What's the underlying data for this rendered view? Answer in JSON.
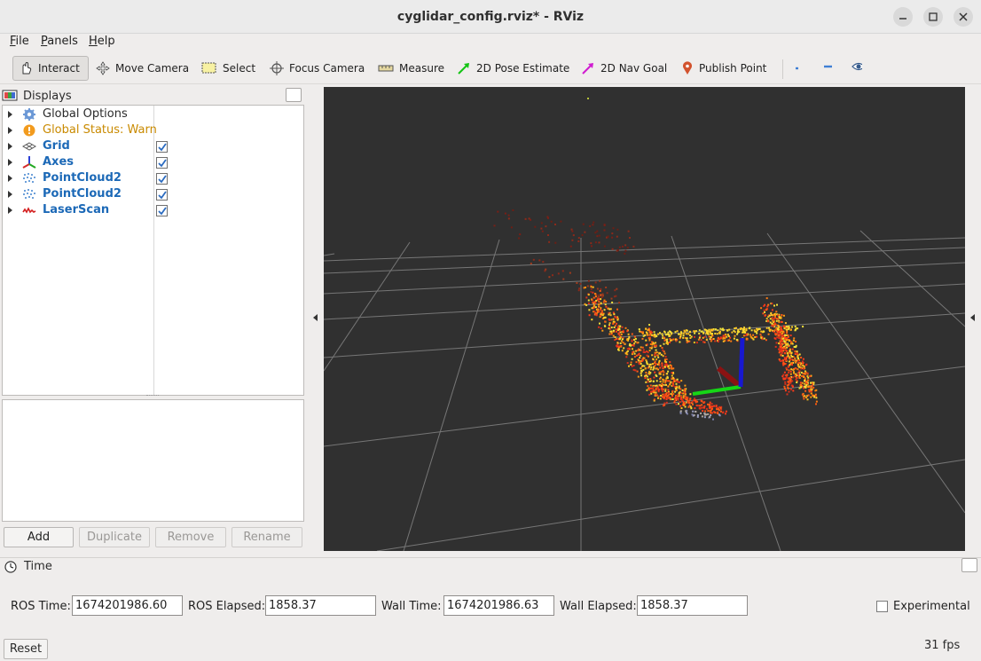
{
  "window": {
    "title": "cyglidar_config.rviz* - RViz"
  },
  "menu": [
    {
      "ul": "F",
      "rest": "ile"
    },
    {
      "ul": "P",
      "rest": "anels"
    },
    {
      "ul": "H",
      "rest": "elp"
    }
  ],
  "toolbar": {
    "interact": "Interact",
    "move_camera": "Move Camera",
    "select": "Select",
    "focus_camera": "Focus Camera",
    "measure": "Measure",
    "pose_estimate": "2D Pose Estimate",
    "nav_goal": "2D Nav Goal",
    "publish_point": "Publish Point"
  },
  "displays": {
    "title": "Displays",
    "items": [
      {
        "label": "Global Options",
        "icon": "gear-icon"
      },
      {
        "label": "Global Status: Warn",
        "icon": "warning-icon"
      },
      {
        "label": "Grid",
        "icon": "grid-icon",
        "checked": true
      },
      {
        "label": "Axes",
        "icon": "axes-icon",
        "checked": true
      },
      {
        "label": "PointCloud2",
        "icon": "pointcloud-icon",
        "checked": true
      },
      {
        "label": "PointCloud2",
        "icon": "pointcloud-icon",
        "checked": true
      },
      {
        "label": "LaserScan",
        "icon": "laserscan-icon",
        "checked": true
      }
    ],
    "buttons": {
      "add": "Add",
      "duplicate": "Duplicate",
      "remove": "Remove",
      "rename": "Rename"
    }
  },
  "time": {
    "title": "Time",
    "ros_time_label": "ROS Time:",
    "ros_time": "1674201986.60",
    "ros_elapsed_label": "ROS Elapsed:",
    "ros_elapsed": "1858.37",
    "wall_time_label": "Wall Time:",
    "wall_time": "1674201986.63",
    "wall_elapsed_label": "Wall Elapsed:",
    "wall_elapsed": "1858.37",
    "experimental_label": "Experimental",
    "reset_label": "Reset",
    "fps": "31 fps"
  },
  "colors": {
    "accent": "#1c69b7",
    "warn": "#c98a00",
    "viewport_bg": "#303030"
  }
}
